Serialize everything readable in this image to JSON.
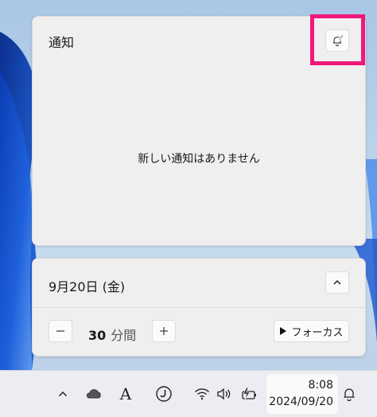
{
  "notifications": {
    "title": "通知",
    "empty_message": "新しい通知はありません",
    "dnd_icon": "bell-snooze-icon",
    "highlight_color": "#f0187a"
  },
  "calendar": {
    "date_label": "9月20日 (金)",
    "collapse_icon": "chevron-up-icon"
  },
  "focus": {
    "minus_icon": "minus-icon",
    "plus_icon": "plus-icon",
    "duration_value": "30",
    "duration_unit": "分間",
    "start_label": "フォーカス",
    "start_icon": "play-icon"
  },
  "taskbar": {
    "icons": [
      "chevron-up-icon",
      "cloud-icon",
      "ime-icon",
      "app-icon",
      "wifi-icon",
      "volume-icon",
      "battery-icon"
    ],
    "ime_label": "A",
    "time": "8:08",
    "date": "2024/09/20",
    "notification_icon": "bell-icon"
  }
}
